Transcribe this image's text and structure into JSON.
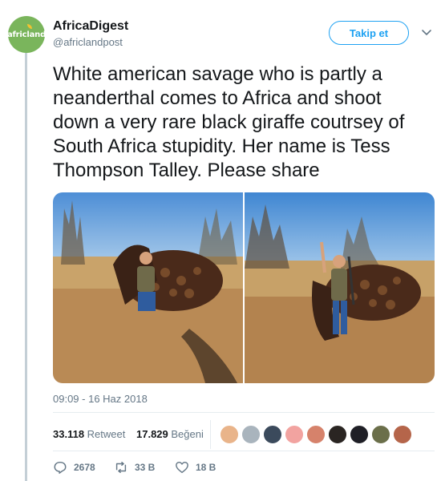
{
  "account": {
    "display_name": "AfricaDigest",
    "handle": "@africlandpost",
    "avatar_text": "africland"
  },
  "follow_button": "Takip et",
  "tweet": {
    "text": "White american savage who is partly a neanderthal comes to Africa and shoot down a very rare black giraffe coutrsey of South Africa stupidity. Her name is Tess Thompson Talley. Please share",
    "timestamp": "09:09 - 16 Haz 2018"
  },
  "stats": {
    "retweets_count": "33.118",
    "retweets_label": "Retweet",
    "likes_count": "17.829",
    "likes_label": "Beğeni"
  },
  "likers": [
    {
      "icon": "avatar",
      "color": "#e9b48a"
    },
    {
      "icon": "avatar",
      "color": "#a9b4bd"
    },
    {
      "icon": "avatar",
      "color": "#3b4a5c"
    },
    {
      "icon": "avatar",
      "color": "#f2a3a0"
    },
    {
      "icon": "avatar",
      "color": "#d6826b"
    },
    {
      "icon": "avatar",
      "color": "#2a2522"
    },
    {
      "icon": "avatar",
      "color": "#1f1f26"
    },
    {
      "icon": "avatar",
      "color": "#6b6f4a"
    },
    {
      "icon": "avatar",
      "color": "#b5654a"
    }
  ],
  "actions": {
    "reply_count": "2678",
    "retweet_count": "33 B",
    "like_count": "18 B"
  },
  "colors": {
    "accent": "#1da1f2",
    "text_primary": "#14171a",
    "text_secondary": "#657786",
    "avatar_bg": "#7ab55c"
  }
}
